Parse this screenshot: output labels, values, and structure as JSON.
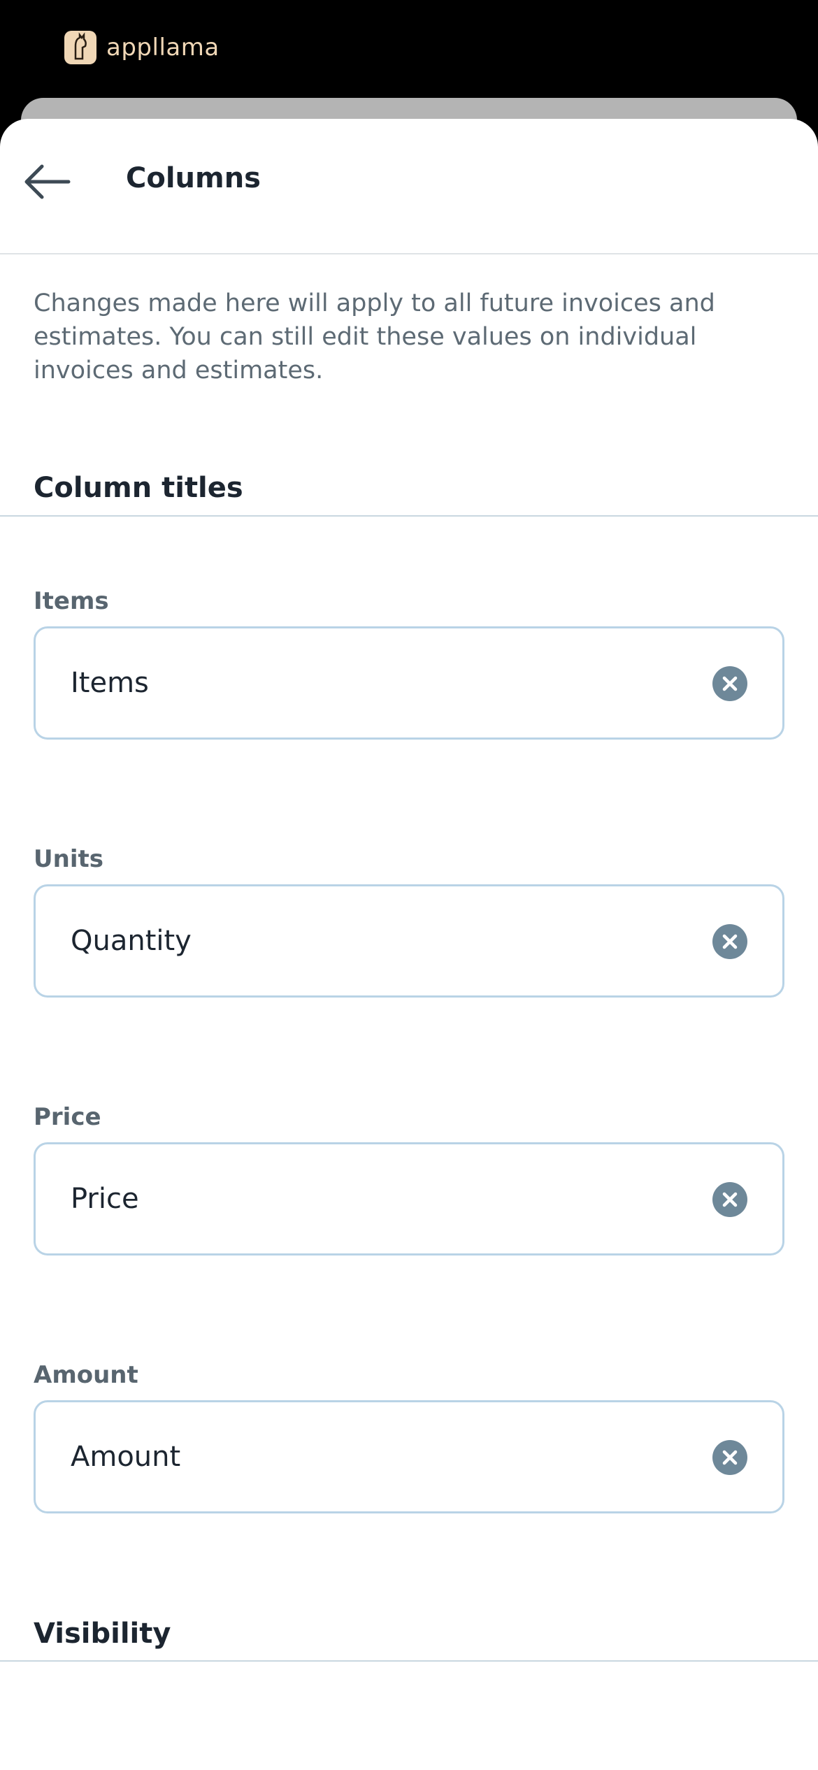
{
  "brand": {
    "name": "appllama",
    "logo_icon": "llama-logo-icon"
  },
  "header": {
    "back_icon": "arrow-left-icon",
    "title": "Columns"
  },
  "description": "Changes made here will apply to all future invoices and estimates. You can still edit these values on individual invoices and estimates.",
  "sections": {
    "column_titles": "Column titles",
    "visibility": "Visibility"
  },
  "fields": [
    {
      "label": "Items",
      "value": "Items",
      "clear_icon": "clear-circle-icon"
    },
    {
      "label": "Units",
      "value": "Quantity",
      "clear_icon": "clear-circle-icon"
    },
    {
      "label": "Price",
      "value": "Price",
      "clear_icon": "clear-circle-icon"
    },
    {
      "label": "Amount",
      "value": "Amount",
      "clear_icon": "clear-circle-icon"
    }
  ],
  "colors": {
    "accent_border": "#b9d3e6",
    "clear_icon": "#6e8899",
    "brand": "#f0d7b6"
  }
}
